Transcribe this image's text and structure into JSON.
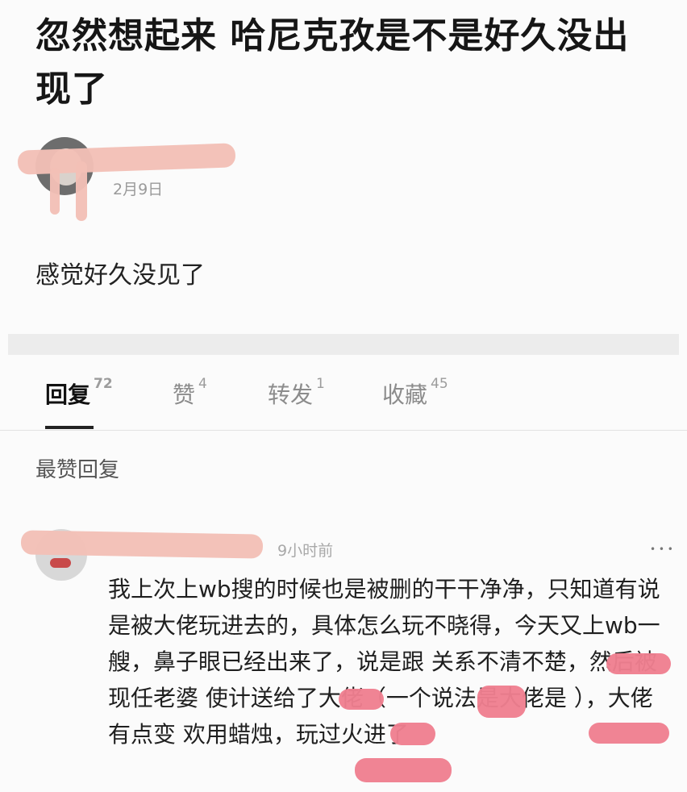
{
  "post": {
    "title": "忽然想起来 哈尼克孜是不是好久没出现了",
    "date": "2月9日",
    "body": "感觉好久没见了"
  },
  "tabs": [
    {
      "label": "回复",
      "count": "72"
    },
    {
      "label": "赞",
      "count": "4"
    },
    {
      "label": "转发",
      "count": "1"
    },
    {
      "label": "收藏",
      "count": "45"
    }
  ],
  "replies_section": {
    "label": "最赞回复"
  },
  "reply": {
    "time": "9小时前",
    "more": "• • •",
    "text": "我上次上wb搜的时候也是被删的干干净净，只知道有说是被大佬玩进去的，具体怎么玩不晓得，今天又上wb一艘，鼻子眼已经出来了，说是跟  关系不清不楚，然后被  现任老婆  使计送给了大佬（一个说法是大佬是  ），大佬有点变  欢用蜡烛，玩过火进了"
  },
  "colors": {
    "redaction_peach": "#f3bfb6",
    "redaction_pink": "#ef7f90",
    "active_tab": "#111111",
    "inactive_tab": "#8c8c8c"
  }
}
